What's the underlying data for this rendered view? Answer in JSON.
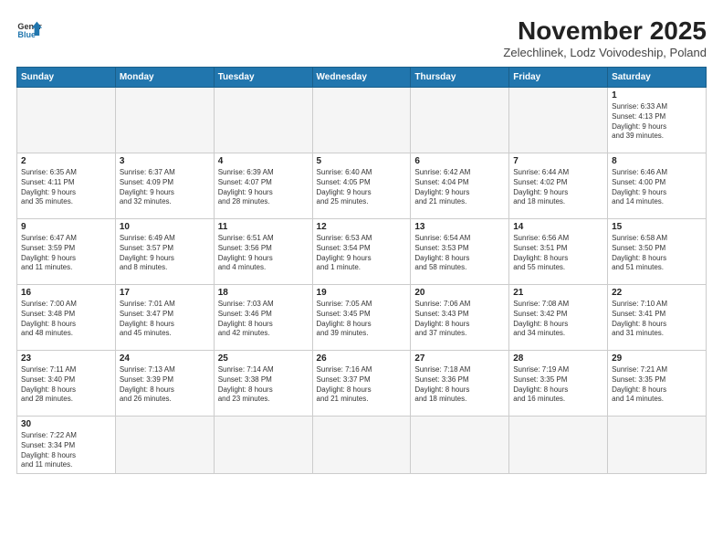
{
  "header": {
    "logo_general": "General",
    "logo_blue": "Blue",
    "month_title": "November 2025",
    "subtitle": "Zelechlinek, Lodz Voivodeship, Poland"
  },
  "weekdays": [
    "Sunday",
    "Monday",
    "Tuesday",
    "Wednesday",
    "Thursday",
    "Friday",
    "Saturday"
  ],
  "weeks": [
    [
      {
        "day": "",
        "info": ""
      },
      {
        "day": "",
        "info": ""
      },
      {
        "day": "",
        "info": ""
      },
      {
        "day": "",
        "info": ""
      },
      {
        "day": "",
        "info": ""
      },
      {
        "day": "",
        "info": ""
      },
      {
        "day": "1",
        "info": "Sunrise: 6:33 AM\nSunset: 4:13 PM\nDaylight: 9 hours\nand 39 minutes."
      }
    ],
    [
      {
        "day": "2",
        "info": "Sunrise: 6:35 AM\nSunset: 4:11 PM\nDaylight: 9 hours\nand 35 minutes."
      },
      {
        "day": "3",
        "info": "Sunrise: 6:37 AM\nSunset: 4:09 PM\nDaylight: 9 hours\nand 32 minutes."
      },
      {
        "day": "4",
        "info": "Sunrise: 6:39 AM\nSunset: 4:07 PM\nDaylight: 9 hours\nand 28 minutes."
      },
      {
        "day": "5",
        "info": "Sunrise: 6:40 AM\nSunset: 4:05 PM\nDaylight: 9 hours\nand 25 minutes."
      },
      {
        "day": "6",
        "info": "Sunrise: 6:42 AM\nSunset: 4:04 PM\nDaylight: 9 hours\nand 21 minutes."
      },
      {
        "day": "7",
        "info": "Sunrise: 6:44 AM\nSunset: 4:02 PM\nDaylight: 9 hours\nand 18 minutes."
      },
      {
        "day": "8",
        "info": "Sunrise: 6:46 AM\nSunset: 4:00 PM\nDaylight: 9 hours\nand 14 minutes."
      }
    ],
    [
      {
        "day": "9",
        "info": "Sunrise: 6:47 AM\nSunset: 3:59 PM\nDaylight: 9 hours\nand 11 minutes."
      },
      {
        "day": "10",
        "info": "Sunrise: 6:49 AM\nSunset: 3:57 PM\nDaylight: 9 hours\nand 8 minutes."
      },
      {
        "day": "11",
        "info": "Sunrise: 6:51 AM\nSunset: 3:56 PM\nDaylight: 9 hours\nand 4 minutes."
      },
      {
        "day": "12",
        "info": "Sunrise: 6:53 AM\nSunset: 3:54 PM\nDaylight: 9 hours\nand 1 minute."
      },
      {
        "day": "13",
        "info": "Sunrise: 6:54 AM\nSunset: 3:53 PM\nDaylight: 8 hours\nand 58 minutes."
      },
      {
        "day": "14",
        "info": "Sunrise: 6:56 AM\nSunset: 3:51 PM\nDaylight: 8 hours\nand 55 minutes."
      },
      {
        "day": "15",
        "info": "Sunrise: 6:58 AM\nSunset: 3:50 PM\nDaylight: 8 hours\nand 51 minutes."
      }
    ],
    [
      {
        "day": "16",
        "info": "Sunrise: 7:00 AM\nSunset: 3:48 PM\nDaylight: 8 hours\nand 48 minutes."
      },
      {
        "day": "17",
        "info": "Sunrise: 7:01 AM\nSunset: 3:47 PM\nDaylight: 8 hours\nand 45 minutes."
      },
      {
        "day": "18",
        "info": "Sunrise: 7:03 AM\nSunset: 3:46 PM\nDaylight: 8 hours\nand 42 minutes."
      },
      {
        "day": "19",
        "info": "Sunrise: 7:05 AM\nSunset: 3:45 PM\nDaylight: 8 hours\nand 39 minutes."
      },
      {
        "day": "20",
        "info": "Sunrise: 7:06 AM\nSunset: 3:43 PM\nDaylight: 8 hours\nand 37 minutes."
      },
      {
        "day": "21",
        "info": "Sunrise: 7:08 AM\nSunset: 3:42 PM\nDaylight: 8 hours\nand 34 minutes."
      },
      {
        "day": "22",
        "info": "Sunrise: 7:10 AM\nSunset: 3:41 PM\nDaylight: 8 hours\nand 31 minutes."
      }
    ],
    [
      {
        "day": "23",
        "info": "Sunrise: 7:11 AM\nSunset: 3:40 PM\nDaylight: 8 hours\nand 28 minutes."
      },
      {
        "day": "24",
        "info": "Sunrise: 7:13 AM\nSunset: 3:39 PM\nDaylight: 8 hours\nand 26 minutes."
      },
      {
        "day": "25",
        "info": "Sunrise: 7:14 AM\nSunset: 3:38 PM\nDaylight: 8 hours\nand 23 minutes."
      },
      {
        "day": "26",
        "info": "Sunrise: 7:16 AM\nSunset: 3:37 PM\nDaylight: 8 hours\nand 21 minutes."
      },
      {
        "day": "27",
        "info": "Sunrise: 7:18 AM\nSunset: 3:36 PM\nDaylight: 8 hours\nand 18 minutes."
      },
      {
        "day": "28",
        "info": "Sunrise: 7:19 AM\nSunset: 3:35 PM\nDaylight: 8 hours\nand 16 minutes."
      },
      {
        "day": "29",
        "info": "Sunrise: 7:21 AM\nSunset: 3:35 PM\nDaylight: 8 hours\nand 14 minutes."
      }
    ],
    [
      {
        "day": "30",
        "info": "Sunrise: 7:22 AM\nSunset: 3:34 PM\nDaylight: 8 hours\nand 11 minutes."
      },
      {
        "day": "",
        "info": ""
      },
      {
        "day": "",
        "info": ""
      },
      {
        "day": "",
        "info": ""
      },
      {
        "day": "",
        "info": ""
      },
      {
        "day": "",
        "info": ""
      },
      {
        "day": "",
        "info": ""
      }
    ]
  ]
}
